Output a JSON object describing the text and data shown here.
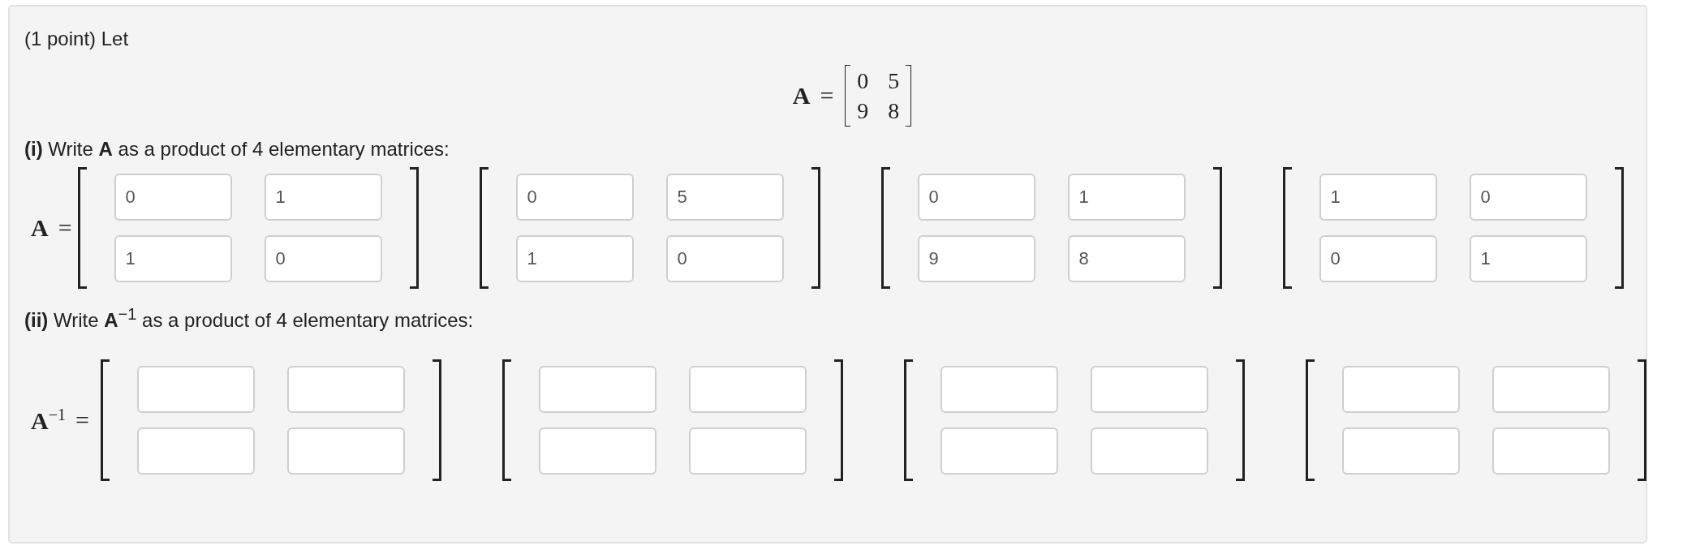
{
  "intro": "(1 point) Let",
  "given": {
    "label": "**A**",
    "equals": "=",
    "rows": [
      [
        "0",
        "5"
      ],
      [
        "9",
        "8"
      ]
    ]
  },
  "parts": [
    {
      "prompt": "**(i)** Write **A** as a product of 4 elementary matrices:",
      "label": "**A**",
      "equals": "=",
      "matrices": [
        {
          "rows": [
            [
              "0",
              "1"
            ],
            [
              "1",
              "0"
            ]
          ]
        },
        {
          "rows": [
            [
              "0",
              "5"
            ],
            [
              "1",
              "0"
            ]
          ]
        },
        {
          "rows": [
            [
              "0",
              "1"
            ],
            [
              "9",
              "8"
            ]
          ]
        },
        {
          "rows": [
            [
              "1",
              "0"
            ],
            [
              "0",
              "1"
            ]
          ]
        }
      ]
    },
    {
      "prompt": "**(ii)** Write **A**$^{−1}$ as a product of 4 elementary matrices:",
      "label": "**A**$^{−1}$",
      "equals": "=",
      "matrices": [
        {
          "rows": [
            [
              null,
              null
            ],
            [
              null,
              null
            ]
          ]
        },
        {
          "rows": [
            [
              null,
              null
            ],
            [
              null,
              null
            ]
          ]
        },
        {
          "rows": [
            [
              null,
              null
            ],
            [
              null,
              null
            ]
          ]
        },
        {
          "rows": [
            [
              null,
              null
            ],
            [
              null,
              null
            ]
          ]
        }
      ]
    }
  ]
}
